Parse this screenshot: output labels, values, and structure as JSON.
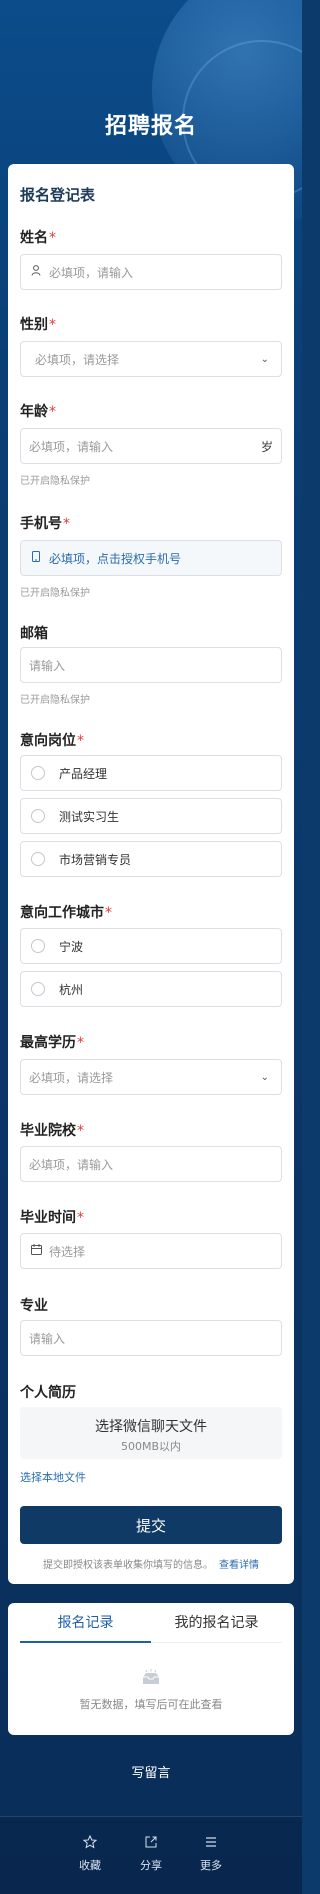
{
  "page": {
    "title": "招聘报名"
  },
  "form": {
    "heading": "报名登记表",
    "fields": {
      "name": {
        "label": "姓名",
        "required": "*",
        "placeholder": "必填项，请输入",
        "icon": "user-icon"
      },
      "gender": {
        "label": "性别",
        "required": "*",
        "placeholder": "必填项，请选择"
      },
      "age": {
        "label": "年龄",
        "required": "*",
        "placeholder": "必填项，请输入",
        "suffix": "岁",
        "hint": "已开启隐私保护"
      },
      "phone": {
        "label": "手机号",
        "required": "*",
        "placeholder": "必填项，点击授权手机号",
        "icon": "phone-icon",
        "hint": "已开启隐私保护"
      },
      "email": {
        "label": "邮箱",
        "placeholder": "请输入",
        "hint": "已开启隐私保护"
      },
      "position": {
        "label": "意向岗位",
        "required": "*",
        "options": [
          "产品经理",
          "测试实习生",
          "市场营销专员"
        ]
      },
      "city": {
        "label": "意向工作城市",
        "required": "*",
        "options": [
          "宁波",
          "杭州"
        ]
      },
      "education": {
        "label": "最高学历",
        "required": "*",
        "placeholder": "必填项，请选择"
      },
      "school": {
        "label": "毕业院校",
        "required": "*",
        "placeholder": "必填项，请输入"
      },
      "graduation": {
        "label": "毕业时间",
        "required": "*",
        "placeholder": "待选择",
        "icon": "calendar-icon"
      },
      "major": {
        "label": "专业",
        "placeholder": "请输入"
      },
      "resume": {
        "label": "个人简历",
        "upload_title": "选择微信聊天文件",
        "upload_limit": "500MB以内",
        "local_link": "选择本地文件"
      }
    },
    "submit_label": "提交",
    "consent_text": "提交即授权该表单收集你填写的信息。",
    "consent_link": "查看详情"
  },
  "records": {
    "tabs": [
      "报名记录",
      "我的报名记录"
    ],
    "empty_text": "暂无数据，填写后可在此查看"
  },
  "message_label": "写留言",
  "bottom_bar": [
    {
      "label": "收藏",
      "icon": "star-icon"
    },
    {
      "label": "分享",
      "icon": "share-icon"
    },
    {
      "label": "更多",
      "icon": "menu-icon"
    }
  ],
  "colors": {
    "primary": "#0f3a66",
    "accent": "#1f5fa8",
    "required": "#e23b3b"
  }
}
